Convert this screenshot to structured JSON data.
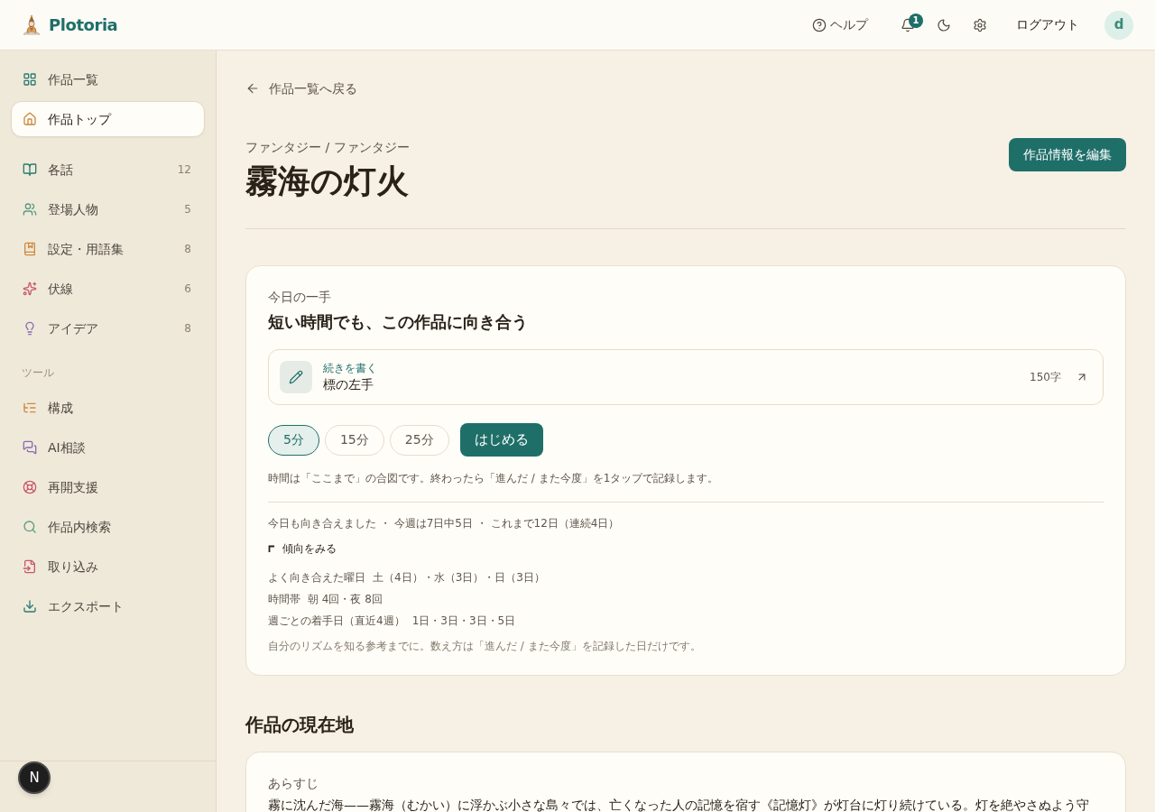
{
  "header": {
    "brand": "Plotoria",
    "help": "ヘルプ",
    "notifications": {
      "count": "1"
    },
    "logout": "ログアウト",
    "avatar": "d"
  },
  "sidebar": {
    "nav": [
      {
        "label": "作品一覧",
        "selected": false
      },
      {
        "label": "作品トップ",
        "selected": true
      }
    ],
    "sections": [
      {
        "label": "各話",
        "count": "12",
        "selected": false
      },
      {
        "label": "登場人物",
        "count": "5",
        "selected": false
      },
      {
        "label": "設定・用語集",
        "count": "8",
        "selected": false
      },
      {
        "label": "伏線",
        "count": "6",
        "selected": false
      },
      {
        "label": "アイデア",
        "count": "8",
        "selected": false
      }
    ],
    "tools_heading": "ツール",
    "tools": [
      {
        "label": "構成",
        "selected": false
      },
      {
        "label": "AI相談",
        "selected": false
      },
      {
        "label": "再開支援",
        "selected": false
      },
      {
        "label": "作品内検索",
        "selected": false
      },
      {
        "label": "取り込み",
        "selected": false
      },
      {
        "label": "エクスポート",
        "selected": false
      }
    ],
    "dev_indicator": "N"
  },
  "main": {
    "back_link": "作品一覧へ戻る",
    "genre": "ファンタジー / ファンタジー",
    "title": "霧海の灯火",
    "edit_button": "作品情報を編集",
    "today_card": {
      "eyebrow": "今日の一手",
      "heading": "短い時間でも、この作品に向き合う",
      "next_action": {
        "label": "続きを書く",
        "title": "標の左手",
        "count": "150字"
      },
      "durations": [
        {
          "label": "5分",
          "selected": true
        },
        {
          "label": "15分",
          "selected": false
        },
        {
          "label": "25分",
          "selected": false
        }
      ],
      "start_button": "はじめる",
      "hint": "時間は「ここまで」の合図です。終わったら「進んだ / また今度」を1タップで記録します。",
      "stats": "今日も向き合えました ・ 今週は7日中5日 ・ これまで12日（連続4日）",
      "trends": {
        "toggle": "傾向をみる",
        "expanded": true,
        "rows": [
          {
            "label": "よく向き合えた曜日",
            "value": "土（4日）・水（3日）・日（3日）"
          },
          {
            "label": "時間帯",
            "value": "朝 4回・夜 8回"
          },
          {
            "label": "週ごとの着手日（直近4週）",
            "value": "1日・3日・3日・5日"
          }
        ],
        "note": "自分のリズムを知る参考までに。数え方は「進んだ / また今度」を記録した日だけです。"
      }
    },
    "status_section": {
      "heading": "作品の現在地",
      "synopsis_label": "あらすじ",
      "synopsis": "霧に沈んだ海——霧海（むかい）に浮かぶ小さな島々では、亡くなった人の記憶を宿す《記憶灯》が灯台に灯り続けている。灯を絶やさぬよう守"
    }
  }
}
